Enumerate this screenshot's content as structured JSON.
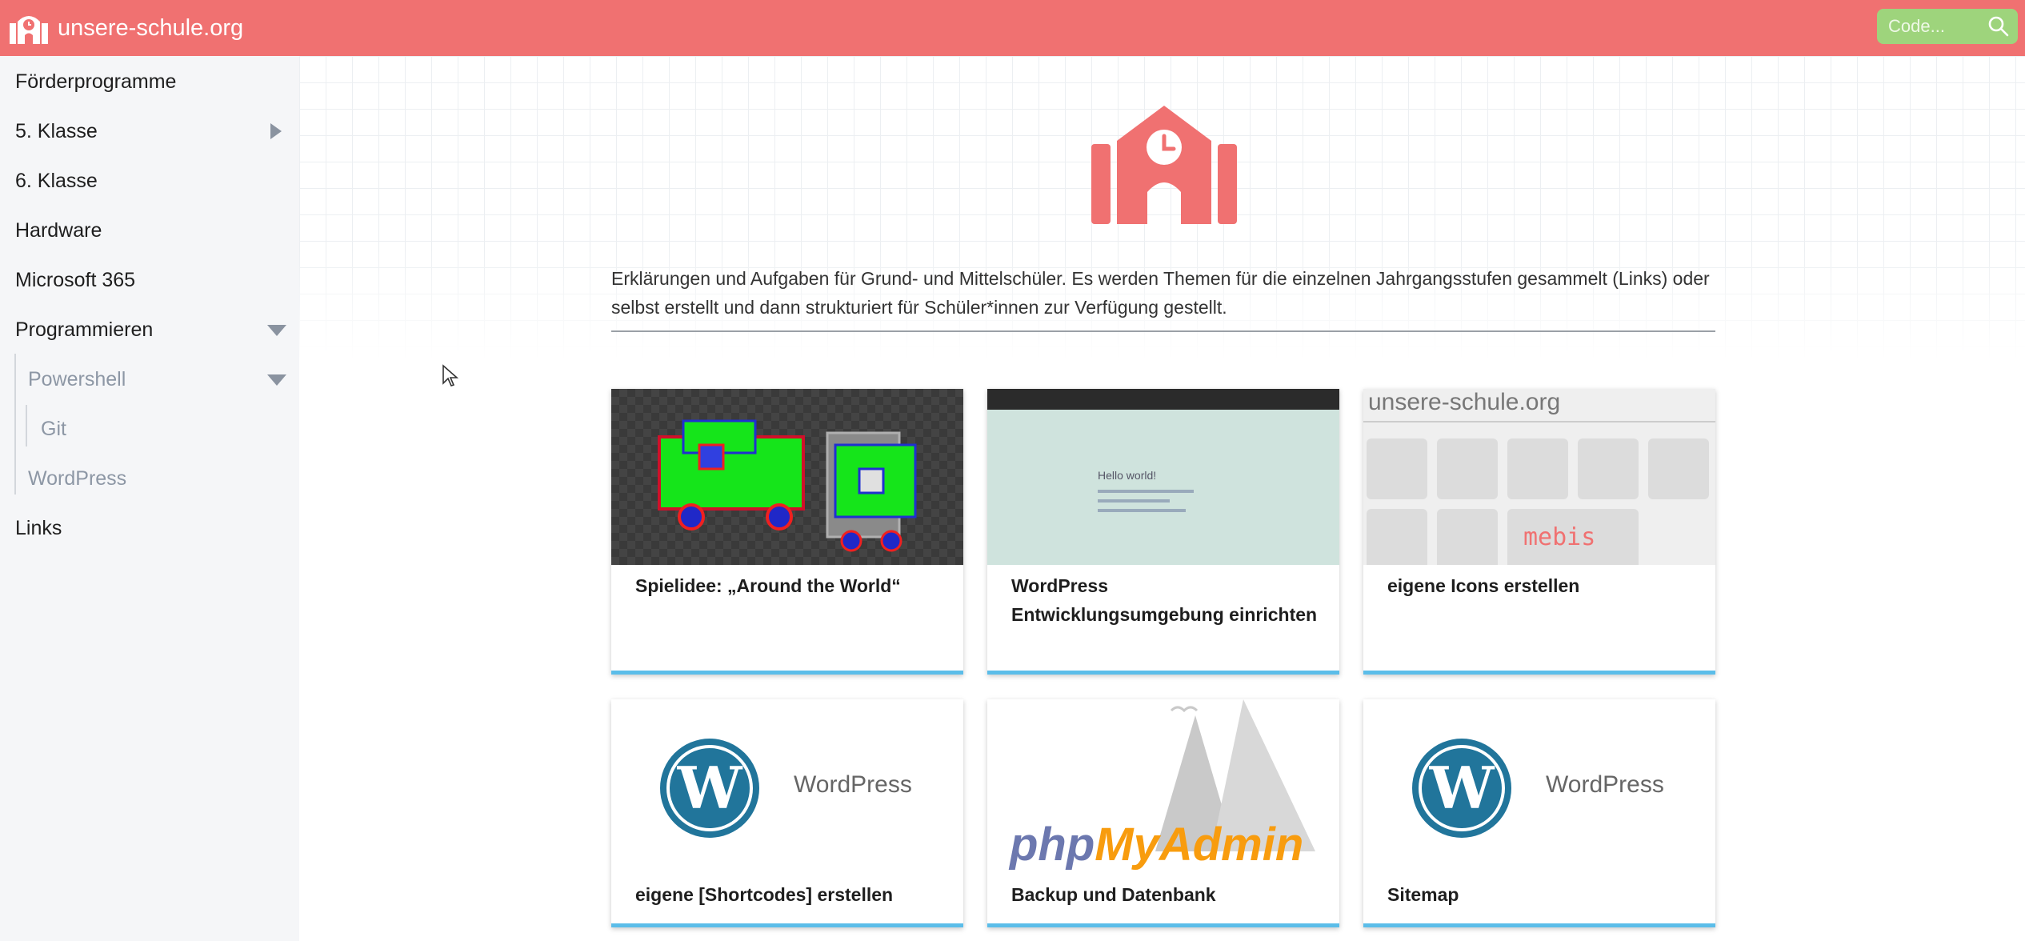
{
  "header": {
    "brand": "unsere-schule.org",
    "search_placeholder": "Code...",
    "colors": {
      "bar": "#f07171",
      "search": "#9ed47c"
    }
  },
  "sidebar": {
    "items": [
      {
        "label": "Förderprogramme"
      },
      {
        "label": "5. Klasse",
        "icon": "chevron-right-icon"
      },
      {
        "label": "6. Klasse"
      },
      {
        "label": "Hardware"
      },
      {
        "label": "Microsoft 365"
      },
      {
        "label": "Programmieren",
        "icon": "chevron-down-icon"
      },
      {
        "label": "Powershell",
        "icon": "chevron-down-icon"
      },
      {
        "label": "Git"
      },
      {
        "label": "WordPress"
      },
      {
        "label": "Links"
      }
    ]
  },
  "main": {
    "intro": "Erklärungen und Aufgaben für Grund- und Mittelschüler. Es werden Themen für die einzelnen Jahrgangsstufen gesammelt (Links) oder selbst erstellt und dann strukturiert für Schüler*innen zur Verfügung gestellt.",
    "cards": [
      {
        "title": "Spielidee: „Around the World“"
      },
      {
        "title": "WordPress Entwicklungsumgebung einrichten",
        "thumb_heading": "Hello world!"
      },
      {
        "title": "eigene Icons erstellen",
        "thumb_heading": "unsere-schule.org",
        "thumb_brand": "mebis"
      },
      {
        "title": "eigene [Shortcodes] erstellen",
        "thumb_brand": "WordPress"
      },
      {
        "title": "Backup und Datenbank",
        "thumb_brand_a": "php",
        "thumb_brand_b": "MyAdmin"
      },
      {
        "title": "Sitemap",
        "thumb_brand": "WordPress"
      }
    ],
    "accent": "#5bbde9"
  }
}
